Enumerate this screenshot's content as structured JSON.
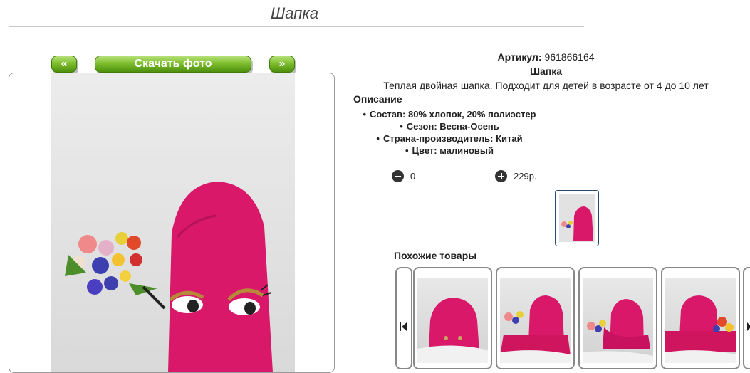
{
  "page": {
    "title": "Шапка"
  },
  "gallery": {
    "prev_label": "«",
    "download_label": "Скачать фото",
    "next_label": "»"
  },
  "product": {
    "article_label": "Артикул:",
    "article_value": "961866164",
    "name": "Шапка",
    "short_description": "Теплая двойная шапка. Подходит для детей в возрасте от 4 до 10 лет",
    "description_heading": "Описание",
    "specs": [
      "Состав: 80% хлопок, 20% полиэстер",
      "Сезон: Весна-Осень",
      "Страна-производитель: Китай",
      "Цвет: малиновый"
    ],
    "quantity": "0",
    "price": "229р.",
    "colors": {
      "hat": "#d9186a",
      "accent": "#5a9e1a"
    }
  },
  "similar": {
    "heading": "Похожие товары",
    "cards": [
      {
        "icon": "hat-photo"
      },
      {
        "icon": "hat-scarf-photo"
      },
      {
        "icon": "hat-scarf-photo"
      },
      {
        "icon": "hat-scarf-photo"
      }
    ]
  }
}
